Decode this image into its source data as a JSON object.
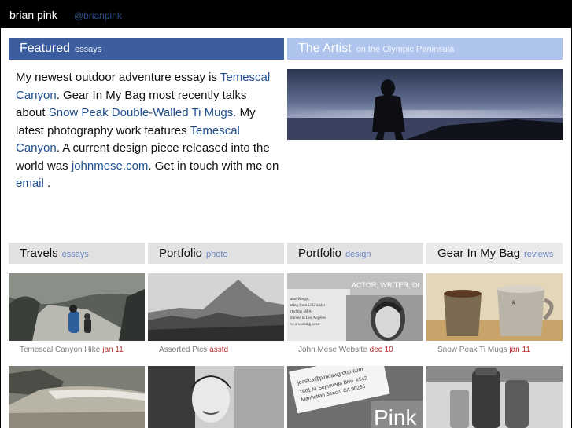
{
  "header": {
    "site_name": "brian pink",
    "handle": "@brianpink"
  },
  "featured": {
    "title": "Featured",
    "subtitle": "essays",
    "text_1": "My newest outdoor adventure essay is ",
    "link_1": "Temescal Canyon",
    "text_2": ". Gear In My Bag most recently talks about ",
    "link_2": "Snow Peak Double-Walled Ti Mugs.",
    "text_3": " My latest photography work features ",
    "link_3": "Temescal Canyon",
    "text_4": ". A current design piece released into the world was ",
    "link_4": "johnmese.com",
    "text_5": ". Get in touch with me on ",
    "link_5": "email",
    "text_6": " ."
  },
  "artist": {
    "title": "The Artist",
    "subtitle": "on the Olympic Peninsula"
  },
  "categories": [
    {
      "title": "Travels",
      "subtitle": "essays"
    },
    {
      "title": "Portfolio",
      "subtitle": "photo"
    },
    {
      "title": "Portfolio",
      "subtitle": "design"
    },
    {
      "title": "Gear In My Bag",
      "subtitle": "reviews"
    }
  ],
  "captions": [
    {
      "title": "Temescal Canyon Hike",
      "date": "jan 11"
    },
    {
      "title": "Assorted Pics",
      "date": "asstd"
    },
    {
      "title": "John Mese Website",
      "date": "dec 10"
    },
    {
      "title": "Snow Peak Ti Mugs",
      "date": "jan 11"
    }
  ],
  "thumb_text": {
    "actor": "ACTOR, WRITER, DI",
    "address_1": "jessica@pinklawgroup.com",
    "address_2": "1601 N. Sepulveda Blvd. #542",
    "address_3": "Manhattan Beach, CA 90266",
    "pink": "Pink",
    "resume": "aton Rouge, eting from LSU under rted the MFA moved to Los Angeles ve a working actor"
  }
}
